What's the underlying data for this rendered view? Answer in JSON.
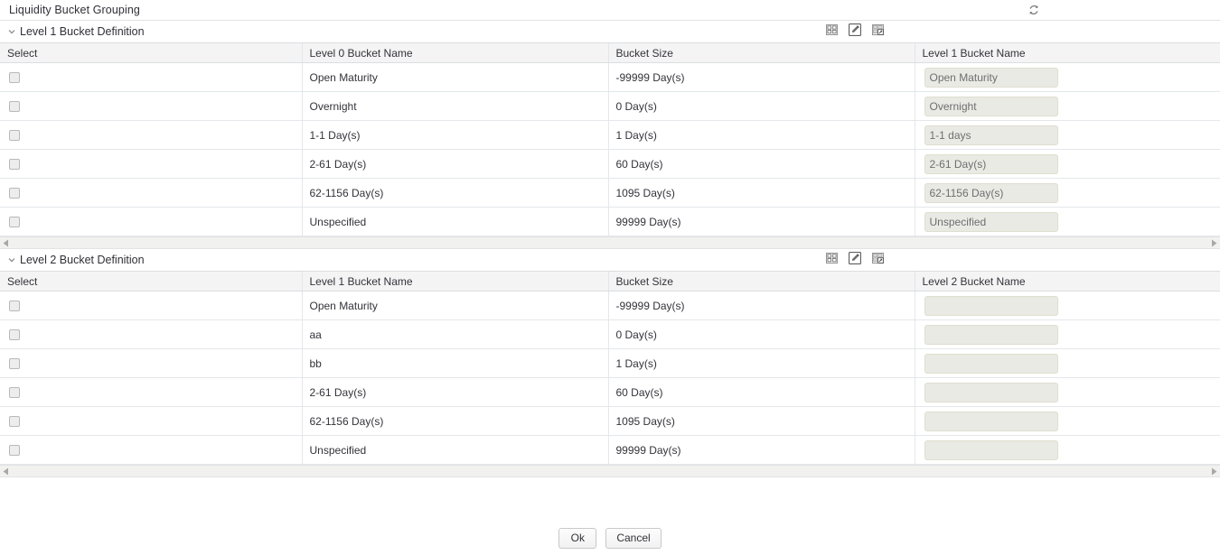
{
  "header": {
    "title": "Liquidity Bucket Grouping",
    "refresh_icon": "refresh-icon"
  },
  "sections": [
    {
      "id": "level1",
      "title": "Level 1 Bucket Definition",
      "chevron": "chevron-down-icon",
      "tools": [
        {
          "name": "grid-view-icon",
          "label": "Grid View"
        },
        {
          "name": "edit-icon",
          "label": "Edit"
        },
        {
          "name": "export-icon",
          "label": "Export"
        }
      ],
      "columns": [
        "Select",
        "Level 0 Bucket Name",
        "Bucket Size",
        "Level 1 Bucket Name"
      ],
      "rows": [
        {
          "checked": false,
          "source_name": "Open Maturity",
          "bucket_size": "-99999 Day(s)",
          "input_value": "Open Maturity"
        },
        {
          "checked": false,
          "source_name": "Overnight",
          "bucket_size": "0 Day(s)",
          "input_value": "Overnight"
        },
        {
          "checked": false,
          "source_name": "1-1 Day(s)",
          "bucket_size": "1 Day(s)",
          "input_value": "1-1 days"
        },
        {
          "checked": false,
          "source_name": "2-61 Day(s)",
          "bucket_size": "60 Day(s)",
          "input_value": "2-61 Day(s)"
        },
        {
          "checked": false,
          "source_name": "62-1156 Day(s)",
          "bucket_size": "1095 Day(s)",
          "input_value": "62-1156 Day(s)"
        },
        {
          "checked": false,
          "source_name": "Unspecified",
          "bucket_size": "99999 Day(s)",
          "input_value": "Unspecified"
        }
      ]
    },
    {
      "id": "level2",
      "title": "Level 2 Bucket Definition",
      "chevron": "chevron-down-icon",
      "tools": [
        {
          "name": "grid-view-icon",
          "label": "Grid View"
        },
        {
          "name": "edit-icon",
          "label": "Edit"
        },
        {
          "name": "export-icon",
          "label": "Export"
        }
      ],
      "columns": [
        "Select",
        "Level 1 Bucket Name",
        "Bucket Size",
        "Level 2 Bucket Name"
      ],
      "rows": [
        {
          "checked": false,
          "source_name": "Open Maturity",
          "bucket_size": "-99999 Day(s)",
          "input_value": ""
        },
        {
          "checked": false,
          "source_name": "aa",
          "bucket_size": "0 Day(s)",
          "input_value": ""
        },
        {
          "checked": false,
          "source_name": "bb",
          "bucket_size": "1 Day(s)",
          "input_value": ""
        },
        {
          "checked": false,
          "source_name": "2-61 Day(s)",
          "bucket_size": "60 Day(s)",
          "input_value": ""
        },
        {
          "checked": false,
          "source_name": "62-1156 Day(s)",
          "bucket_size": "1095 Day(s)",
          "input_value": ""
        },
        {
          "checked": false,
          "source_name": "Unspecified",
          "bucket_size": "99999 Day(s)",
          "input_value": ""
        }
      ]
    }
  ],
  "scrollbar": {
    "left_arrow_icon": "scroll-left-arrow-icon",
    "right_arrow_icon": "scroll-right-arrow-icon"
  },
  "footer": {
    "ok_label": "Ok",
    "cancel_label": "Cancel"
  },
  "colors": {
    "header_bg": "#f4f4f5",
    "input_bg": "#eaeae4",
    "text": "#33333a",
    "border": "#e4e7ea"
  }
}
